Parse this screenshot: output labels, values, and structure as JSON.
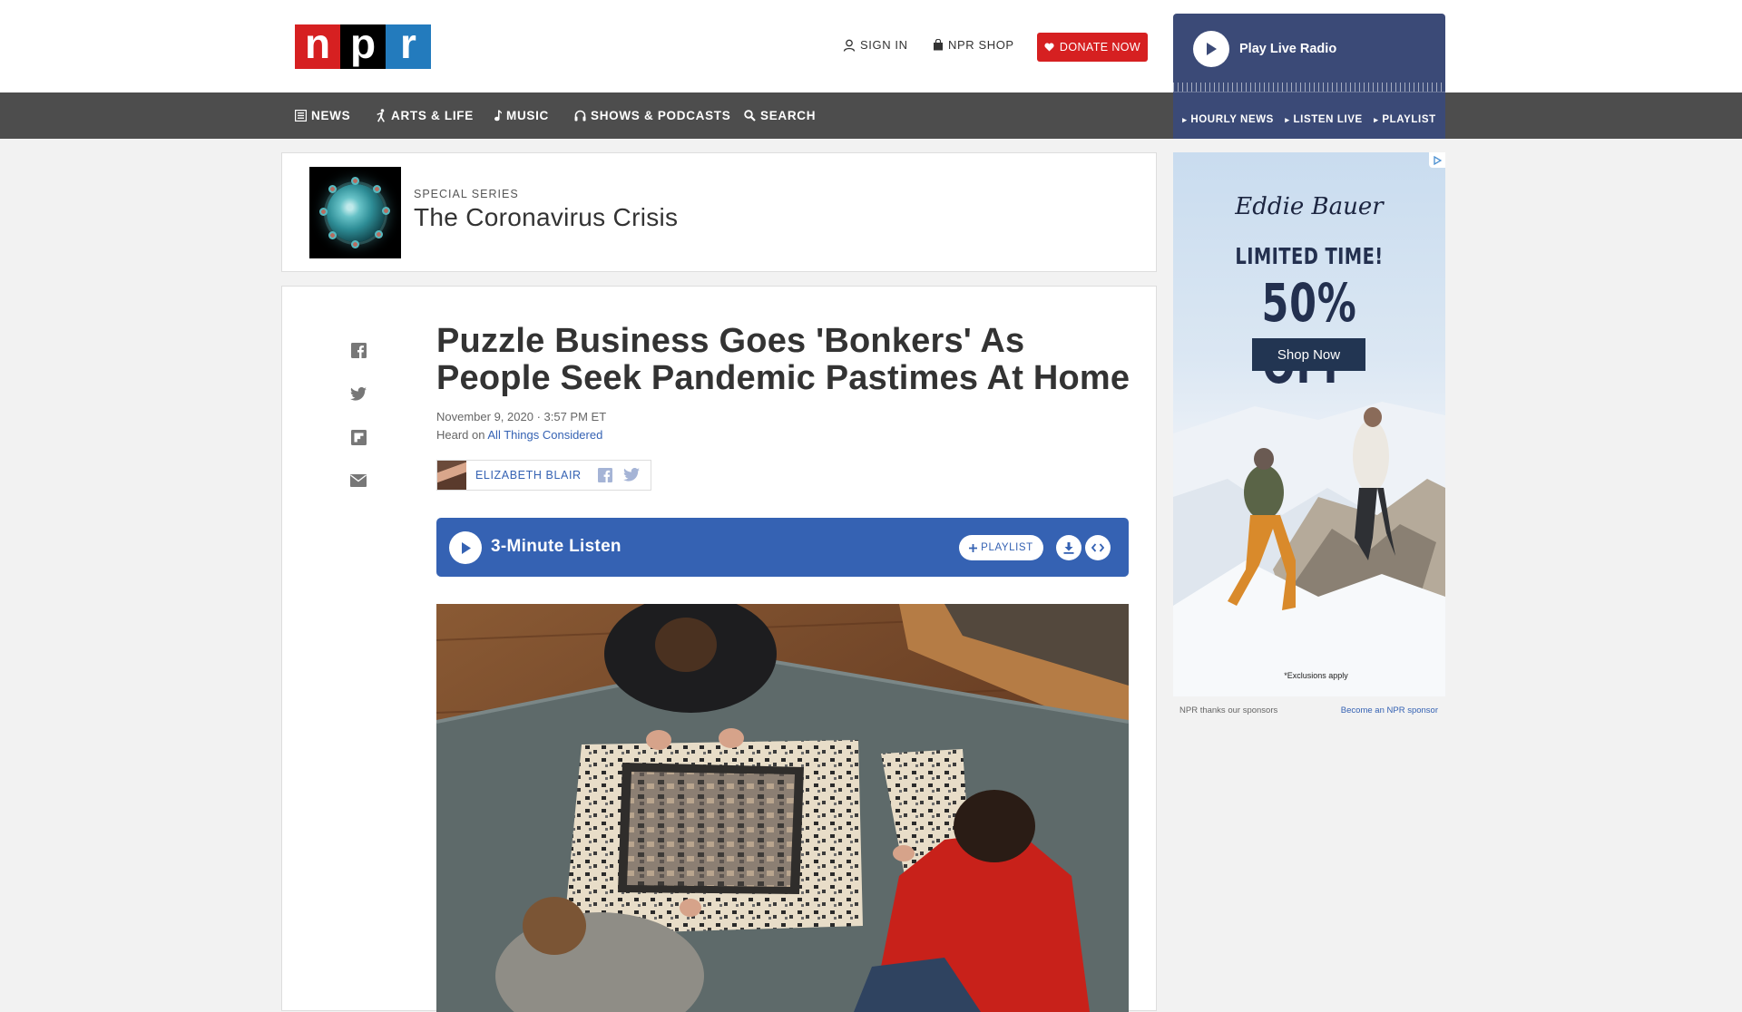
{
  "header": {
    "logo": {
      "letters": [
        "n",
        "p",
        "r"
      ],
      "colors": [
        "#d62021",
        "#000000",
        "#237bbd"
      ]
    },
    "sign_in": "SIGN IN",
    "shop": "NPR SHOP",
    "donate": "DONATE NOW"
  },
  "nav": {
    "items": [
      {
        "label": "NEWS",
        "icon": "news-icon"
      },
      {
        "label": "ARTS & LIFE",
        "icon": "arts-icon"
      },
      {
        "label": "MUSIC",
        "icon": "music-note-icon"
      },
      {
        "label": "SHOWS & PODCASTS",
        "icon": "headphones-icon"
      },
      {
        "label": "SEARCH",
        "icon": "search-icon"
      }
    ]
  },
  "live_radio": {
    "label": "Play Live Radio",
    "links": [
      "HOURLY NEWS",
      "LISTEN LIVE",
      "PLAYLIST"
    ],
    "bg_color": "#3b4a77"
  },
  "series": {
    "kicker": "SPECIAL SERIES",
    "title": "The Coronavirus Crisis"
  },
  "article": {
    "headline": "Puzzle Business Goes 'Bonkers' As People Seek Pandemic Pastimes At Home",
    "date": "November 9, 2020 · 3:57 PM ET",
    "heard_on_prefix": "Heard on",
    "heard_on_show": "All Things Considered",
    "author": "ELIZABETH BLAIR",
    "share_icons": [
      "facebook-icon",
      "twitter-icon",
      "flipboard-icon",
      "email-icon"
    ]
  },
  "audio": {
    "title": "3-Minute Listen",
    "playlist": "PLAYLIST",
    "accent": "#3562b3"
  },
  "ad": {
    "brand": "Eddie Bauer",
    "headline": "LIMITED TIME!",
    "offer": "50% OFF",
    "offer_mark": "*",
    "cta": "Shop Now",
    "disclaimer": "*Exclusions apply"
  },
  "sponsor": {
    "thanks": "NPR thanks our sponsors",
    "become": "Become an NPR sponsor"
  }
}
